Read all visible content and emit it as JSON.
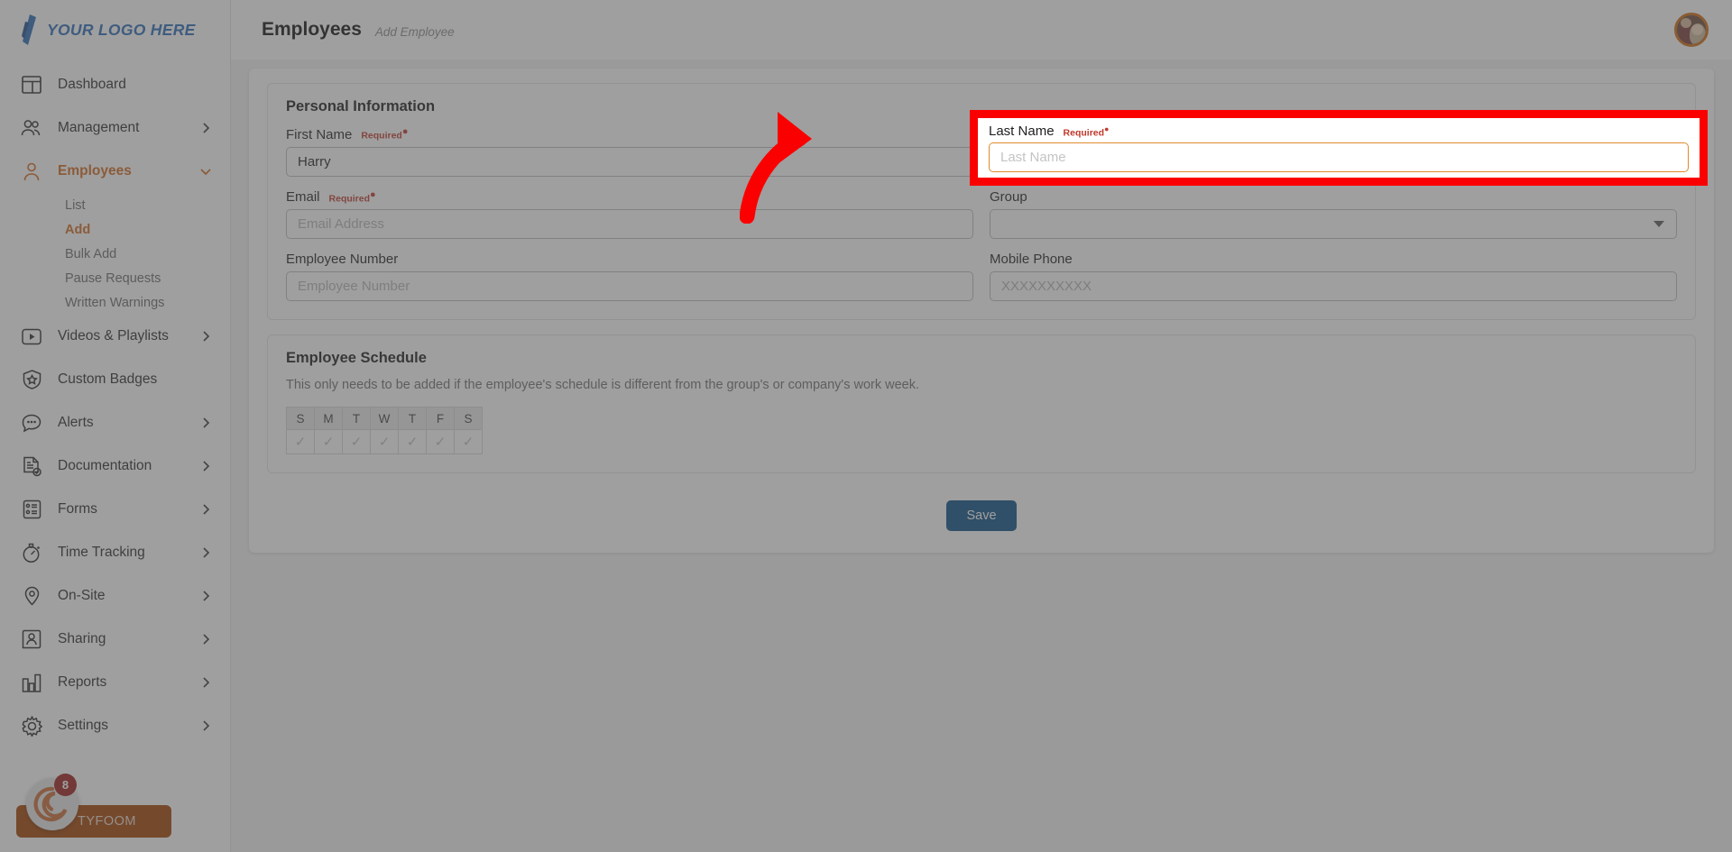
{
  "brand": {
    "logo_text": "YOUR LOGO HERE",
    "logo_color": "#2b6cb8",
    "accent_color": "#d2691e",
    "tyfoom_label": "TYFOOM",
    "tyfoom_badge_count": "8",
    "tyfoom_bg": "#a34200"
  },
  "sidebar": {
    "items": [
      {
        "label": "Dashboard",
        "icon": "dashboard-icon",
        "expandable": false,
        "active": false
      },
      {
        "label": "Management",
        "icon": "people-icon",
        "expandable": true,
        "active": false
      },
      {
        "label": "Employees",
        "icon": "person-icon",
        "expandable": true,
        "active": true,
        "subitems": [
          {
            "label": "List",
            "active": false
          },
          {
            "label": "Add",
            "active": true
          },
          {
            "label": "Bulk Add",
            "active": false
          },
          {
            "label": "Pause Requests",
            "active": false
          },
          {
            "label": "Written Warnings",
            "active": false
          }
        ]
      },
      {
        "label": "Videos & Playlists",
        "icon": "play-box-icon",
        "expandable": true,
        "active": false
      },
      {
        "label": "Custom Badges",
        "icon": "shield-star-icon",
        "expandable": false,
        "active": false
      },
      {
        "label": "Alerts",
        "icon": "alert-chat-icon",
        "expandable": true,
        "active": false
      },
      {
        "label": "Documentation",
        "icon": "document-check-icon",
        "expandable": true,
        "active": false
      },
      {
        "label": "Forms",
        "icon": "form-list-icon",
        "expandable": true,
        "active": false
      },
      {
        "label": "Time Tracking",
        "icon": "stopwatch-icon",
        "expandable": true,
        "active": false
      },
      {
        "label": "On-Site",
        "icon": "map-pin-icon",
        "expandable": true,
        "active": false
      },
      {
        "label": "Sharing",
        "icon": "share-person-icon",
        "expandable": true,
        "active": false
      },
      {
        "label": "Reports",
        "icon": "bar-chart-icon",
        "expandable": true,
        "active": false
      },
      {
        "label": "Settings",
        "icon": "gear-icon",
        "expandable": true,
        "active": false
      }
    ]
  },
  "header": {
    "title": "Employees",
    "breadcrumb": "Add Employee",
    "avatar_alt": "user-avatar"
  },
  "form": {
    "personal_information": {
      "section_title": "Personal Information",
      "required_label": "Required",
      "fields": {
        "first_name": {
          "label": "First Name",
          "value": "Harry",
          "placeholder": "First Name",
          "required": true
        },
        "last_name": {
          "label": "Last Name",
          "value": "",
          "placeholder": "Last Name",
          "required": true,
          "focused": true
        },
        "email": {
          "label": "Email",
          "value": "",
          "placeholder": "Email Address",
          "required": true
        },
        "group": {
          "label": "Group",
          "value": "",
          "placeholder": "",
          "required": false,
          "type": "select"
        },
        "employee_number": {
          "label": "Employee Number",
          "value": "",
          "placeholder": "Employee Number",
          "required": false
        },
        "mobile_phone": {
          "label": "Mobile Phone",
          "value": "",
          "placeholder": "XXXXXXXXXX",
          "required": false
        }
      }
    },
    "employee_schedule": {
      "section_title": "Employee Schedule",
      "description": "This only needs to be added if the employee's schedule is different from the group's or company's work week.",
      "day_headers": [
        "S",
        "M",
        "T",
        "W",
        "T",
        "F",
        "S"
      ],
      "day_checked": [
        "✓",
        "✓",
        "✓",
        "✓",
        "✓",
        "✓",
        "✓"
      ]
    },
    "save_label": "Save",
    "save_color": "#0a4e85"
  },
  "annotation": {
    "highlight_color": "#fb0000",
    "arrow_color": "#fb0000",
    "highlight_target": "last-name-field"
  }
}
